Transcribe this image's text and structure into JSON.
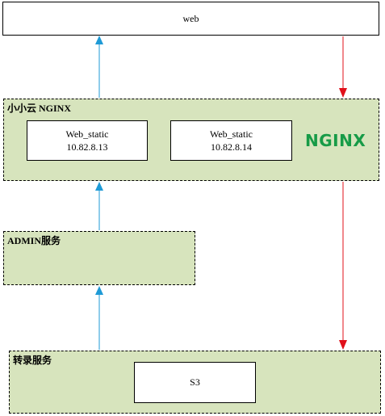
{
  "web_box": {
    "label": "web"
  },
  "nginx_group": {
    "label": "小小云 NGINX",
    "servers": [
      {
        "name": "Web_static",
        "ip": "10.82.8.13"
      },
      {
        "name": "Web_static",
        "ip": "10.82.8.14"
      }
    ],
    "logo_text": "NGINX"
  },
  "admin_group": {
    "label": "ADMIN服务"
  },
  "transcode_group": {
    "label": "转录服务",
    "storage": {
      "label": "S3"
    }
  },
  "colors": {
    "group_fill": "#d7e4bd",
    "up_arrow": "#1e9ad6",
    "down_arrow": "#e0101a",
    "logo_green": "#179b47"
  }
}
